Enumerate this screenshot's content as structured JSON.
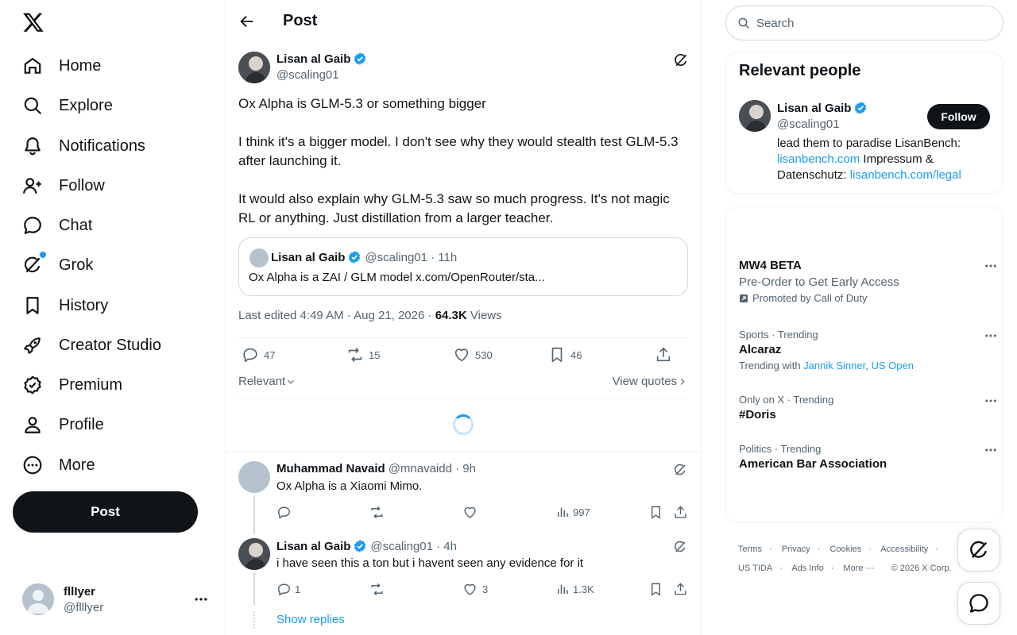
{
  "nav": {
    "items": [
      {
        "label": "Home",
        "icon": "home-icon"
      },
      {
        "label": "Explore",
        "icon": "search-icon"
      },
      {
        "label": "Notifications",
        "icon": "bell-icon"
      },
      {
        "label": "Follow",
        "icon": "person-plus-icon"
      },
      {
        "label": "Chat",
        "icon": "chat-bubble-icon"
      },
      {
        "label": "Grok",
        "icon": "grok-icon"
      },
      {
        "label": "History",
        "icon": "bookmark-icon"
      },
      {
        "label": "Creator Studio",
        "icon": "rocket-icon"
      },
      {
        "label": "Premium",
        "icon": "verified-badge-icon"
      },
      {
        "label": "Profile",
        "icon": "person-icon"
      },
      {
        "label": "More",
        "icon": "more-circle-icon"
      }
    ],
    "post_button": "Post",
    "account": {
      "name": "fllIyer",
      "handle": "@flllyer"
    }
  },
  "header": {
    "title": "Post"
  },
  "tweet": {
    "author": "Lisan al Gaib",
    "handle": "@scaling01",
    "text": "Ox Alpha is GLM-5.3 or something bigger\n\nI think it's a bigger model. I don't see why they would stealth test GLM-5.3 after launching it.\n\nIt would also explain why GLM-5.3 saw so much progress. It's not magic RL or anything. Just distillation from a larger teacher.",
    "quote": {
      "author": "Lisan al Gaib",
      "handle_time": "@scaling01 · 11h",
      "text": "Ox Alpha is a ZAI / GLM model x.com/OpenRouter/sta..."
    },
    "meta_prefix": "Last edited 4:49 AM · Aug 21, 2026 ·",
    "views_count": "64.3K",
    "views_label": "Views",
    "actions": {
      "replies": "47",
      "reposts": "15",
      "likes": "530",
      "bookmarks": "46"
    },
    "sort_label": "Relevant",
    "view_quotes": "View quotes"
  },
  "replies": [
    {
      "author": "Muhammad Navaid",
      "handle_time": "@mnavaidd · 9h",
      "text": "Ox Alpha is a Xiaomi Mimo.",
      "replies": "",
      "likes": "",
      "views": "997"
    },
    {
      "author": "Lisan al Gaib",
      "handle_time": "@scaling01 · 4h",
      "text": "i have seen this a ton but i havent seen any evidence for it",
      "replies": "1",
      "likes": "3",
      "views": "1.3K"
    }
  ],
  "show_replies": "Show replies",
  "right": {
    "search_placeholder": "Search",
    "relevant_title": "Relevant people",
    "person": {
      "name": "Lisan al Gaib",
      "handle": "@scaling01",
      "follow": "Follow",
      "bio_1": "lead them to paradise LisanBench:",
      "bio_link1": "lisanbench.com",
      "bio_2": " Impressum & Datenschutz: ",
      "bio_link2": "lisanbench.com/legal"
    },
    "promo": {
      "title": "MW4 BETA",
      "subtitle": "Pre-Order to Get Early Access",
      "by": "Promoted by Call of Duty"
    },
    "trends": [
      {
        "context": "Sports · Trending",
        "title": "Alcaraz",
        "sub_prefix": "Trending with ",
        "sub_link1": "Jannik Sinner",
        "sep": ", ",
        "sub_link2": "US Open"
      },
      {
        "context": "Only on X · Trending",
        "title": "#Doris"
      },
      {
        "context": "Politics · Trending",
        "title": "American Bar Association"
      }
    ],
    "footer": {
      "row1": [
        "Terms",
        "Privacy",
        "Cookies",
        "Accessibility"
      ],
      "row2": [
        "US TIDA",
        "Ads Info",
        "More ···",
        "© 2026 X Corp."
      ]
    }
  },
  "colors": {
    "accent": "#1d9bf0",
    "text": "#0f1419",
    "muted": "#536471",
    "border": "#eff3f4"
  }
}
